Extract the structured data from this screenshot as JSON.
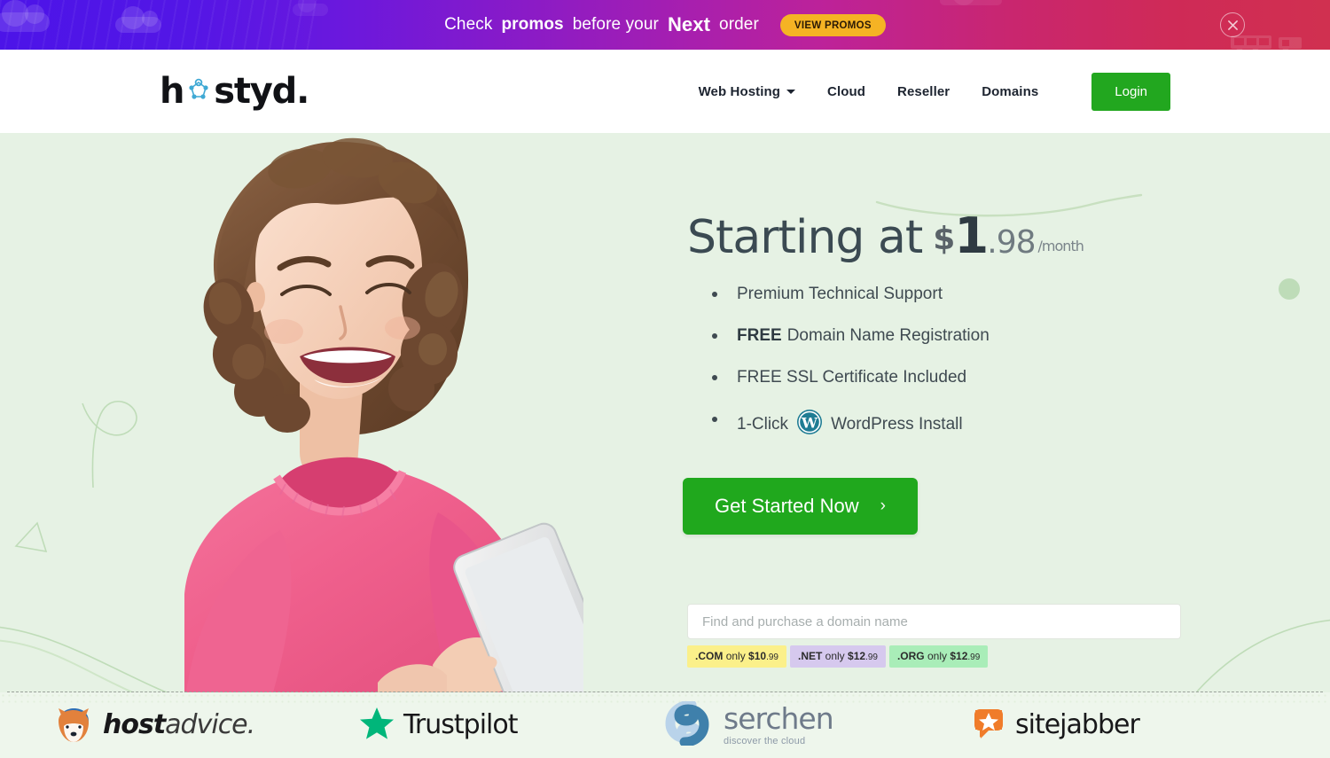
{
  "promo_banner": {
    "text_prefix": "Check",
    "text_bold1": "promos",
    "text_mid": "before your",
    "text_bold2": "Next",
    "text_suffix": "order",
    "cta_label": "VIEW PROMOS",
    "close_icon": "close-icon",
    "gradient_start": "#4c14e8",
    "gradient_end": "#d03050",
    "cta_color": "#f5b324"
  },
  "header": {
    "logo": {
      "part1": "h",
      "part2": "styd.",
      "node_icon": "network-node-icon",
      "node_color": "#3fa9d4"
    },
    "nav": [
      {
        "label": "Web Hosting",
        "has_dropdown": true
      },
      {
        "label": "Cloud",
        "has_dropdown": false
      },
      {
        "label": "Reseller",
        "has_dropdown": false
      },
      {
        "label": "Domains",
        "has_dropdown": false
      }
    ],
    "login_label": "Login",
    "login_color": "#22a71f"
  },
  "hero": {
    "background": "#e6f2e4",
    "headline": {
      "lead": "Starting at",
      "currency": "$",
      "whole": "1",
      "cents": ".98",
      "period": "/month"
    },
    "features": [
      {
        "bold": "",
        "text": "Premium Technical Support",
        "icon": ""
      },
      {
        "bold": "FREE",
        "text": "Domain Name Registration",
        "icon": ""
      },
      {
        "bold": "",
        "text": "FREE SSL Certificate Included",
        "icon": ""
      },
      {
        "bold": "",
        "text_before": "1-Click",
        "text": "WordPress Install",
        "icon": "wordpress-icon"
      }
    ],
    "cta": {
      "label": "Get Started Now",
      "chevron": "›",
      "color": "#20a81d"
    },
    "domain_search": {
      "placeholder": "Find and purchase a domain name",
      "value": ""
    },
    "tld_badges": [
      {
        "tld": ".COM",
        "only": "only",
        "price": "$10",
        "cents": ".99",
        "bg": "#fbf08a"
      },
      {
        "tld": ".NET",
        "only": "only",
        "price": "$12",
        "cents": ".99",
        "bg": "#d6c9ee"
      },
      {
        "tld": ".ORG",
        "only": "only",
        "price": "$12",
        "cents": ".99",
        "bg": "#a9edb8"
      }
    ],
    "portrait_alt": "laughing-woman-with-phone"
  },
  "review_bar": {
    "items": [
      {
        "name": "hostadvice",
        "name_bold": "host",
        "name_thin": "advice.",
        "icon": "hostadvice-fox-icon",
        "tagline": ""
      },
      {
        "name": "Trustpilot",
        "icon": "trustpilot-star-icon",
        "tagline": ""
      },
      {
        "name": "serchen",
        "icon": "serchen-swirl-icon",
        "tagline": "discover the cloud"
      },
      {
        "name": "sitejabber",
        "icon": "sitejabber-star-bubble-icon",
        "tagline": ""
      }
    ]
  }
}
